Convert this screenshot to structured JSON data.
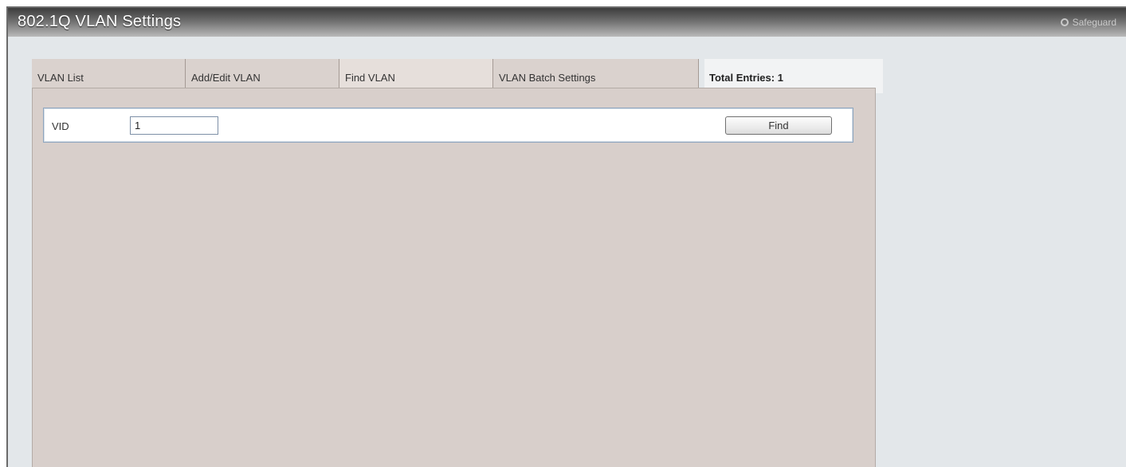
{
  "window": {
    "title": "802.1Q VLAN Settings",
    "safeguard_label": "Safeguard"
  },
  "tabs": [
    {
      "label": "VLAN List",
      "active": false
    },
    {
      "label": "Add/Edit VLAN",
      "active": false
    },
    {
      "label": "Find VLAN",
      "active": true
    },
    {
      "label": "VLAN Batch Settings",
      "active": false
    }
  ],
  "total_entries": "Total Entries: 1",
  "find_form": {
    "vid_label": "VID",
    "vid_value": "1",
    "find_button_label": "Find"
  },
  "colors": {
    "panel_background": "#d8cfcb",
    "frame_background": "#e3e7ea",
    "search_border": "#8ea6bf"
  }
}
